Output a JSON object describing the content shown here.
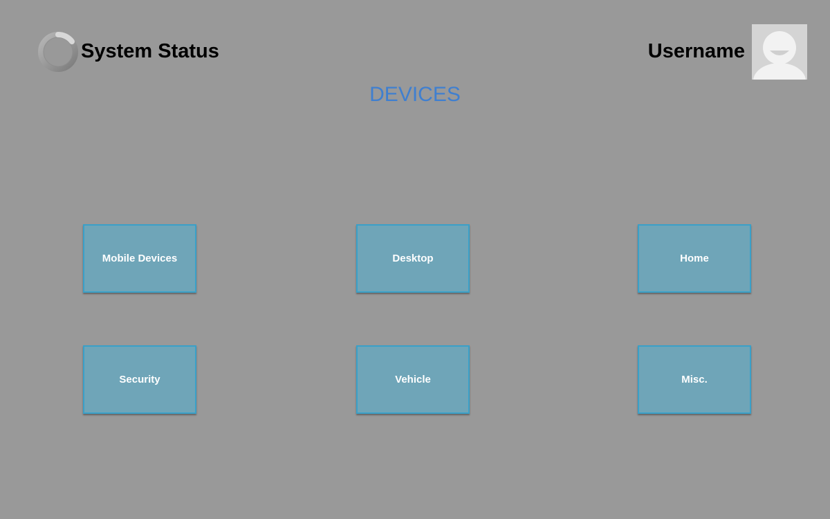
{
  "header": {
    "title": "System Status",
    "status_icon": "loading-ring-icon",
    "username": "Username",
    "avatar_icon": "user-avatar-icon"
  },
  "main": {
    "heading": "DEVICES",
    "categories": [
      {
        "label": "Mobile Devices"
      },
      {
        "label": "Desktop"
      },
      {
        "label": "Home"
      },
      {
        "label": "Security"
      },
      {
        "label": "Vehicle"
      },
      {
        "label": "Misc."
      }
    ]
  },
  "colors": {
    "background": "#999999",
    "heading": "#3f7fd0",
    "tile_fill": "#6fa5b8",
    "tile_border": "#3aa0c8",
    "tile_text": "#ffffff"
  }
}
